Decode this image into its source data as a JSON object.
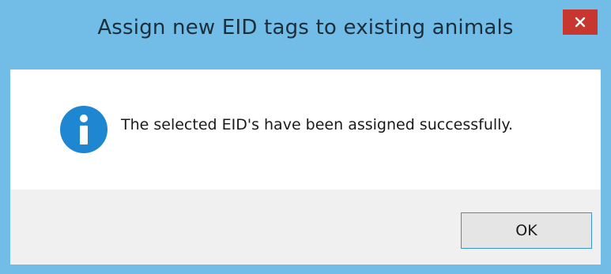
{
  "window": {
    "title": "Assign new EID tags to existing animals",
    "close_icon": "close-icon"
  },
  "content": {
    "icon": "info-icon",
    "message": "The selected EID's have been assigned successfully."
  },
  "footer": {
    "ok_label": "OK"
  },
  "colors": {
    "frame": "#71bde7",
    "close_button": "#c7372f",
    "info_icon": "#1f86d1",
    "footer_bg": "#f0f0f0",
    "button_border": "#3c8fd0"
  }
}
